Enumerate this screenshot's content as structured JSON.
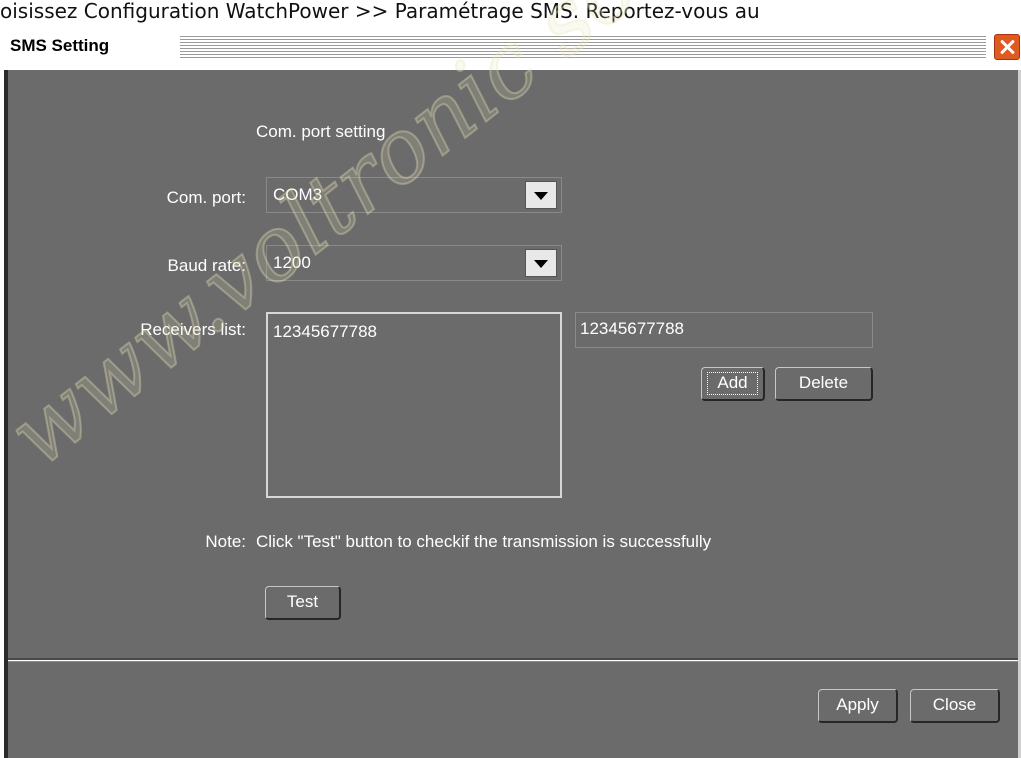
{
  "document_caption": "oisissez Configuration WatchPower >> Paramétrage SMS. Reportez-vous au",
  "window": {
    "title": "SMS Setting"
  },
  "section": {
    "heading": "Com. port setting"
  },
  "form": {
    "com_port_label": "Com. port:",
    "com_port_value": "COM3",
    "baud_rate_label": "Baud rate:",
    "baud_rate_value": "1200",
    "receivers_label": "Receivers list:",
    "receivers": [
      "12345677788"
    ],
    "receiver_input_value": "12345677788",
    "add_label": "Add",
    "delete_label": "Delete"
  },
  "note": {
    "label": "Note:",
    "text": "Click \"Test\" button to checkif the transmission is successfully",
    "test_label": "Test"
  },
  "footer": {
    "apply_label": "Apply",
    "close_label": "Close"
  },
  "watermark": {
    "text": "www.voltronic solar",
    "color": "#e9e6b8"
  },
  "colors": {
    "panel": "#6b6b6b",
    "close_button": "#e05a20"
  }
}
